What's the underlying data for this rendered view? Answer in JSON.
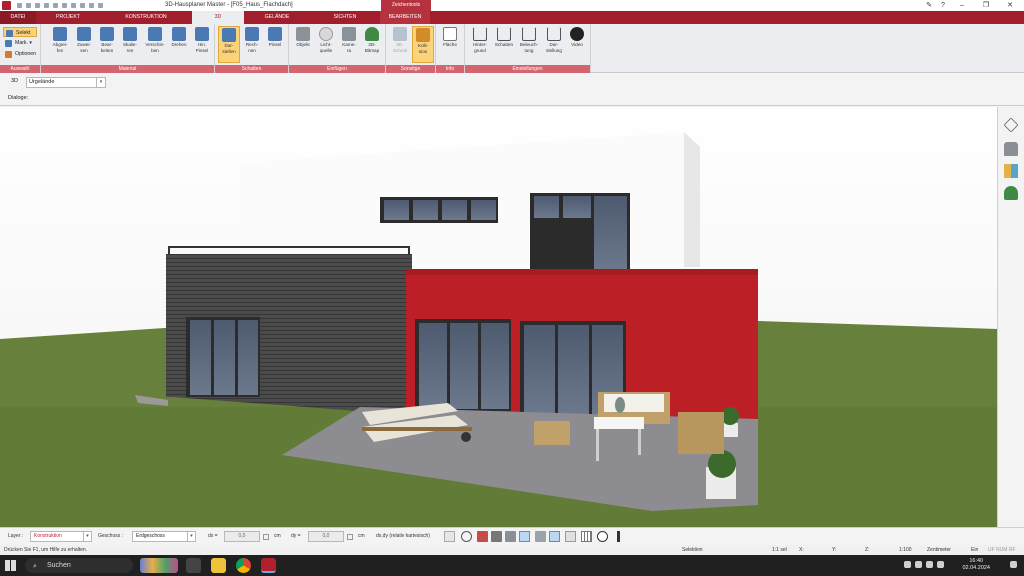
{
  "window": {
    "title": "3D-Hausplaner Master - [F05_Haus_Flachdach]",
    "context_tab": "Zeichentools"
  },
  "tabs": [
    {
      "label": "DATEI"
    },
    {
      "label": "PROJEKT"
    },
    {
      "label": "KONSTRUKTION"
    },
    {
      "label": "3D"
    },
    {
      "label": "GELÄNDE"
    },
    {
      "label": "SICHTEN"
    },
    {
      "label": "BEARBEITEN"
    }
  ],
  "ribbon": {
    "auswahl": {
      "selekt": "Selekt",
      "mark": "Mark.",
      "optionen": "Optionen",
      "label": "Auswahl"
    },
    "material": {
      "label": "Material",
      "buttons": [
        "Abgrei-\nfen",
        "Zuwei-\nsen",
        "Bear-\nbeiten",
        "Skalie-\nren",
        "Verschie-\nben",
        "Drehen",
        "Hin.\nPinsel"
      ]
    },
    "schatten": {
      "label": "Schatten",
      "buttons": [
        "Dar-\nstellen",
        "Rech-\nnen",
        "Pinsel"
      ]
    },
    "einfuegen": {
      "label": "Einfügen",
      "buttons": [
        "Objekt",
        "Licht-\nquelle",
        "Kame-\nra",
        "3D-\nBitmap"
      ]
    },
    "sonstige": {
      "label": "Sonstige",
      "buttons": [
        "3D-\nSchnitt",
        "Kolli-\nsion"
      ]
    },
    "info": {
      "label": "Info",
      "buttons": [
        "Fläche"
      ]
    },
    "einstellungen": {
      "label": "Einstellungen",
      "buttons": [
        "Hinter-\ngrund",
        "Schatten",
        "Beleuch-\ntung",
        "Dar-\nstellung",
        "Video"
      ]
    }
  },
  "view": {
    "label": "3D",
    "combo_value": "Urgelände",
    "dialog_label": "Dialoge:"
  },
  "statusbar": {
    "layer_label": "Layer :",
    "layer_value": "Konstruktion",
    "geschoss_label": "Geschoss :",
    "geschoss_value": "Erdgeschoss",
    "dx_label": "dx =",
    "dx_value": "0,0",
    "dy_label": "dy =",
    "dy_value": "0,0",
    "unit1": "cm",
    "unit2": "cm",
    "mode": "dx,dy (relativ kartesisch)"
  },
  "statusbar2": {
    "help": "Drücken Sie F1, um Hilfe zu erhalten.",
    "selektion": "Selektion",
    "scale1": "1:1 sel",
    "x": "X:",
    "y": "Y:",
    "z": "Z:",
    "scale2": "1:100",
    "unit": "Zentimeter",
    "ein": "Ein",
    "flags": "UF NUM RF"
  },
  "taskbar": {
    "search": "Suchen",
    "time": "16:40",
    "date": "02.04.2024"
  },
  "colors": {
    "brand": "#a11f2d",
    "active_button": "#fbd37a",
    "group_label": "#d2656f"
  }
}
